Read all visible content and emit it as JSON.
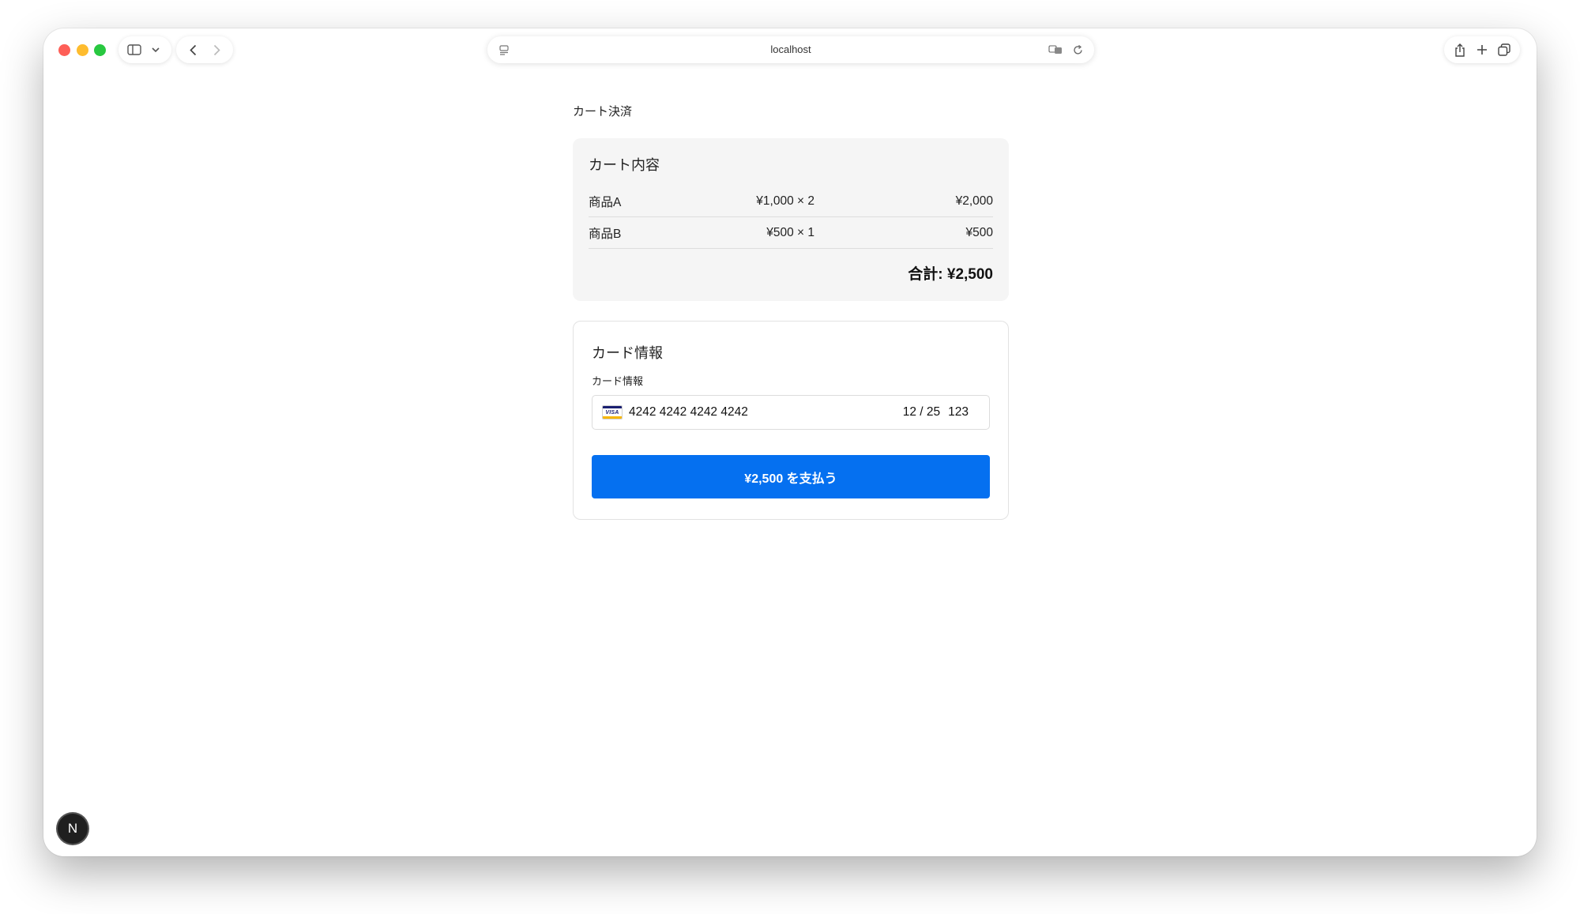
{
  "browser": {
    "address": "localhost",
    "icons": {
      "sidebar": "sidebar-icon",
      "chevron": "chevron-down-icon",
      "back": "back-arrow-icon",
      "forward": "forward-arrow-icon",
      "page_settings": "page-menu-icon",
      "translate": "translate-icon",
      "reload": "reload-icon",
      "share": "share-icon",
      "new_tab": "plus-icon",
      "tabs": "tab-overview-icon"
    }
  },
  "page": {
    "heading": "カート決済"
  },
  "cart": {
    "title": "カート内容",
    "items": [
      {
        "name": "商品A",
        "quantity": "¥1,000 × 2",
        "subtotal": "¥2,000"
      },
      {
        "name": "商品B",
        "quantity": "¥500 × 1",
        "subtotal": "¥500"
      }
    ],
    "total": "合計: ¥2,500"
  },
  "card": {
    "title": "カード情報",
    "label": "カード情報",
    "brand": "VISA",
    "number": "4242 4242 4242 4242",
    "expiry": "12 / 25",
    "cvc": "123"
  },
  "pay_button": {
    "label": "¥2,500 を支払う",
    "color": "#0570f0"
  },
  "dev_badge": {
    "label": "N"
  }
}
